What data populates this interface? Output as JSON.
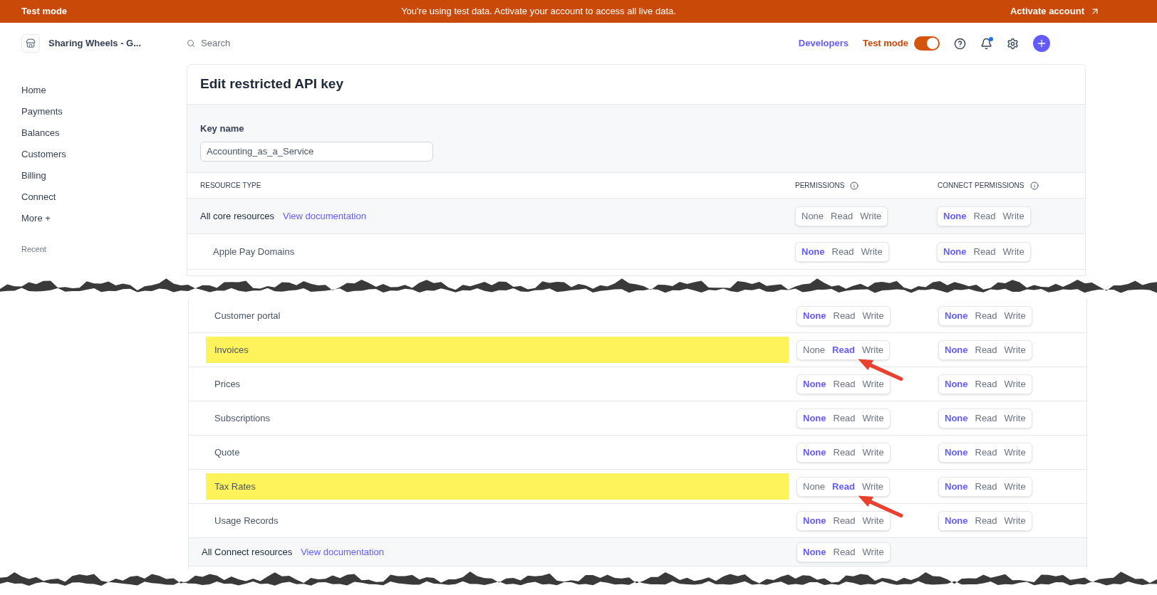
{
  "banner": {
    "label": "Test mode",
    "message": "You're using test data. Activate your account to access all live data.",
    "action": "Activate account"
  },
  "account": {
    "name": "Sharing Wheels - G..."
  },
  "search": {
    "placeholder": "Search"
  },
  "header": {
    "developers": "Developers",
    "test_mode": {
      "label": "Test mode",
      "on": true
    }
  },
  "sidebar": {
    "items": [
      "Home",
      "Payments",
      "Balances",
      "Customers",
      "Billing",
      "Connect",
      "More +"
    ],
    "section": "Recent"
  },
  "page": {
    "title": "Edit restricted API key",
    "key_name": {
      "label": "Key name",
      "value": "Accounting_as_a_Service"
    },
    "columns": [
      {
        "label": "RESOURCE TYPE",
        "info": false
      },
      {
        "label": "PERMISSIONS",
        "info": true
      },
      {
        "label": "CONNECT PERMISSIONS",
        "info": true
      }
    ],
    "sections": [
      {
        "rows": [
          {
            "kind": "group",
            "name": "All core resources",
            "link": "View documentation",
            "highlighted": false,
            "annotated": false,
            "permissions": [
              {
                "label": "None",
                "selected": false
              },
              {
                "label": "Read",
                "selected": false
              },
              {
                "label": "Write",
                "selected": false
              }
            ],
            "connect_permissions": [
              {
                "label": "None",
                "selected": true
              },
              {
                "label": "Read",
                "selected": false
              },
              {
                "label": "Write",
                "selected": false
              }
            ]
          },
          {
            "kind": "resource",
            "name": "Apple Pay Domains",
            "highlighted": false,
            "annotated": false,
            "permissions": [
              {
                "label": "None",
                "selected": true
              },
              {
                "label": "Read",
                "selected": false
              },
              {
                "label": "Write",
                "selected": false
              }
            ],
            "connect_permissions": [
              {
                "label": "None",
                "selected": true
              },
              {
                "label": "Read",
                "selected": false
              },
              {
                "label": "Write",
                "selected": false
              }
            ]
          }
        ]
      },
      {
        "rows": [
          {
            "kind": "resource",
            "name": "Customer portal",
            "highlighted": false,
            "annotated": false,
            "permissions": [
              {
                "label": "None",
                "selected": true
              },
              {
                "label": "Read",
                "selected": false
              },
              {
                "label": "Write",
                "selected": false
              }
            ],
            "connect_permissions": [
              {
                "label": "None",
                "selected": true
              },
              {
                "label": "Read",
                "selected": false
              },
              {
                "label": "Write",
                "selected": false
              }
            ]
          },
          {
            "kind": "resource",
            "name": "Invoices",
            "highlighted": true,
            "annotated": true,
            "permissions": [
              {
                "label": "None",
                "selected": false
              },
              {
                "label": "Read",
                "selected": true
              },
              {
                "label": "Write",
                "selected": false
              }
            ],
            "connect_permissions": [
              {
                "label": "None",
                "selected": true
              },
              {
                "label": "Read",
                "selected": false
              },
              {
                "label": "Write",
                "selected": false
              }
            ]
          },
          {
            "kind": "resource",
            "name": "Prices",
            "highlighted": false,
            "annotated": false,
            "permissions": [
              {
                "label": "None",
                "selected": true
              },
              {
                "label": "Read",
                "selected": false
              },
              {
                "label": "Write",
                "selected": false
              }
            ],
            "connect_permissions": [
              {
                "label": "None",
                "selected": true
              },
              {
                "label": "Read",
                "selected": false
              },
              {
                "label": "Write",
                "selected": false
              }
            ]
          },
          {
            "kind": "resource",
            "name": "Subscriptions",
            "highlighted": false,
            "annotated": false,
            "permissions": [
              {
                "label": "None",
                "selected": true
              },
              {
                "label": "Read",
                "selected": false
              },
              {
                "label": "Write",
                "selected": false
              }
            ],
            "connect_permissions": [
              {
                "label": "None",
                "selected": true
              },
              {
                "label": "Read",
                "selected": false
              },
              {
                "label": "Write",
                "selected": false
              }
            ]
          },
          {
            "kind": "resource",
            "name": "Quote",
            "highlighted": false,
            "annotated": false,
            "permissions": [
              {
                "label": "None",
                "selected": true
              },
              {
                "label": "Read",
                "selected": false
              },
              {
                "label": "Write",
                "selected": false
              }
            ],
            "connect_permissions": [
              {
                "label": "None",
                "selected": true
              },
              {
                "label": "Read",
                "selected": false
              },
              {
                "label": "Write",
                "selected": false
              }
            ]
          },
          {
            "kind": "resource",
            "name": "Tax Rates",
            "highlighted": true,
            "annotated": true,
            "permissions": [
              {
                "label": "None",
                "selected": false
              },
              {
                "label": "Read",
                "selected": true
              },
              {
                "label": "Write",
                "selected": false
              }
            ],
            "connect_permissions": [
              {
                "label": "None",
                "selected": true
              },
              {
                "label": "Read",
                "selected": false
              },
              {
                "label": "Write",
                "selected": false
              }
            ]
          },
          {
            "kind": "resource",
            "name": "Usage Records",
            "highlighted": false,
            "annotated": false,
            "permissions": [
              {
                "label": "None",
                "selected": true
              },
              {
                "label": "Read",
                "selected": false
              },
              {
                "label": "Write",
                "selected": false
              }
            ],
            "connect_permissions": [
              {
                "label": "None",
                "selected": true
              },
              {
                "label": "Read",
                "selected": false
              },
              {
                "label": "Write",
                "selected": false
              }
            ]
          },
          {
            "kind": "group",
            "name": "All Connect resources",
            "link": "View documentation",
            "highlighted": false,
            "annotated": false,
            "permissions": [
              {
                "label": "None",
                "selected": true
              },
              {
                "label": "Read",
                "selected": false
              },
              {
                "label": "Write",
                "selected": false
              }
            ]
          }
        ]
      }
    ]
  }
}
